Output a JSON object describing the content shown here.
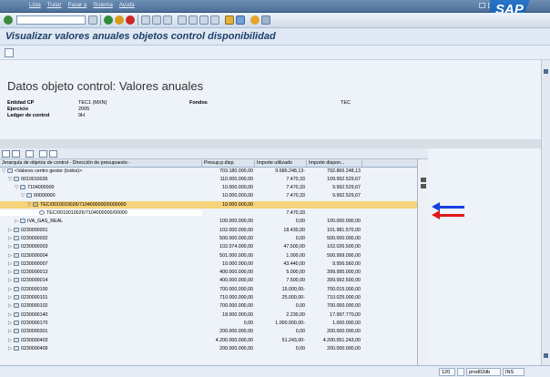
{
  "menubar": {
    "items": [
      "Lista",
      "Tratar",
      "Pasar a",
      "Sistema",
      "Ayuda"
    ],
    "logo_text": "SAP"
  },
  "title": "Visualizar valores anuales objetos control disponibilidad",
  "section_title": "Datos objeto control: Valores anuales",
  "header": {
    "entidad_label": "Entidad CP",
    "entidad_value": "TEC1 (MXN)",
    "fondos_label": "Fondos",
    "fondos_value": "TEC",
    "ejercicio_label": "Ejercicio",
    "ejercicio_value": "2005",
    "ledger_label": "Ledger de control",
    "ledger_value": "9H"
  },
  "grid": {
    "columns": [
      "Jerarquía de objetos de control - Dirección de presupuesto -",
      "Presup.p.disp.",
      "Importe utilizado",
      "Importe dispon..."
    ],
    "rows": [
      {
        "exp": "▽",
        "indent": 0,
        "text": "<Valores centro gestor (todos)>",
        "c1": "703.180.000,00",
        "c2": "9.686.248,13-",
        "c3": "792.866.248,13"
      },
      {
        "exp": "▽",
        "indent": 1,
        "text": "0010010026",
        "c1": "110.000.000,00",
        "c2": "7.470,33",
        "c3": "109.992.529,67"
      },
      {
        "exp": "▽",
        "indent": 2,
        "text": "7104000000",
        "c1": "10.000.000,00",
        "c2": "7.470,33",
        "c3": "9.992.529,67"
      },
      {
        "exp": "▽",
        "indent": 3,
        "text": "00000000",
        "c1": "10.000.000,00",
        "c2": "7.470,33",
        "c3": "9.992.529,67"
      },
      {
        "exp": "▽",
        "indent": 4,
        "text": "TEC/0010010026/7104000000/0000000",
        "c1": "10.000.000,00",
        "c2": "",
        "c3": "",
        "hl": true
      },
      {
        "exp": "",
        "indent": 5,
        "text": "TEC/0010010026/7104000000/00000",
        "c1": "",
        "c2": "7.470,33",
        "c3": "",
        "sel": true
      },
      {
        "exp": "▷",
        "indent": 2,
        "text": "IVA_GAS_REAL",
        "c1": "100.000.000,00",
        "c2": "0,00",
        "c3": "100.000.000,00"
      },
      {
        "exp": "▷",
        "indent": 1,
        "text": "0230000001",
        "c1": "102.000.000,00",
        "c2": "18.430,00",
        "c3": "101.981.570,00"
      },
      {
        "exp": "▷",
        "indent": 1,
        "text": "0230000002",
        "c1": "500.000.000,00",
        "c2": "0,00",
        "c3": "500.000.000,00"
      },
      {
        "exp": "▷",
        "indent": 1,
        "text": "0230000003",
        "c1": "102.074.000,00",
        "c2": "47.500,00",
        "c3": "102.026.500,00"
      },
      {
        "exp": "▷",
        "indent": 1,
        "text": "0230000004",
        "c1": "501.000.000,00",
        "c2": "1.000,00",
        "c3": "500.999.000,00"
      },
      {
        "exp": "▷",
        "indent": 1,
        "text": "0230000007",
        "c1": "10.000.000,00",
        "c2": "43.440,00",
        "c3": "9.956.560,00"
      },
      {
        "exp": "▷",
        "indent": 1,
        "text": "0230000013",
        "c1": "400.000.000,00",
        "c2": "5.000,00",
        "c3": "399.995.000,00"
      },
      {
        "exp": "▷",
        "indent": 1,
        "text": "0230000014",
        "c1": "400.000.000,00",
        "c2": "7.500,00",
        "c3": "399.992.500,00"
      },
      {
        "exp": "▷",
        "indent": 1,
        "text": "0230000100",
        "c1": "700.000.000,00",
        "c2": "15.000,00-",
        "c3": "700.015.000,00"
      },
      {
        "exp": "▷",
        "indent": 1,
        "text": "0230000101",
        "c1": "710.000.000,00",
        "c2": "25.000,00-",
        "c3": "710.025.000,00"
      },
      {
        "exp": "▷",
        "indent": 1,
        "text": "0230000102",
        "c1": "700.000.000,00",
        "c2": "0,00",
        "c3": "700.000.000,00"
      },
      {
        "exp": "▷",
        "indent": 1,
        "text": "0230000140",
        "c1": "18.000.000,00",
        "c2": "2.230,00",
        "c3": "17.997.770,00"
      },
      {
        "exp": "▷",
        "indent": 1,
        "text": "0230000170",
        "c1": "0,00",
        "c2": "1.000.000,00-",
        "c3": "1.000.000,00"
      },
      {
        "exp": "▷",
        "indent": 1,
        "text": "0230000301",
        "c1": "200.000.000,00",
        "c2": "0,00",
        "c3": "200.000.000,00"
      },
      {
        "exp": "▷",
        "indent": 1,
        "text": "0230000403",
        "c1": "4.200.000.000,00",
        "c2": "51.243,00-",
        "c3": "4.200.051.243,00"
      },
      {
        "exp": "▷",
        "indent": 1,
        "text": "0230000409",
        "c1": "200.000.000,00",
        "c2": "0,00",
        "c3": "200.000.000,00"
      }
    ]
  },
  "status": {
    "session": "120",
    "server": "prod02db",
    "mode": "INS"
  },
  "colors": {
    "arrow_blue": "#1a3fe0",
    "arrow_red": "#e01818",
    "highlight_row": "#f6d37a"
  }
}
